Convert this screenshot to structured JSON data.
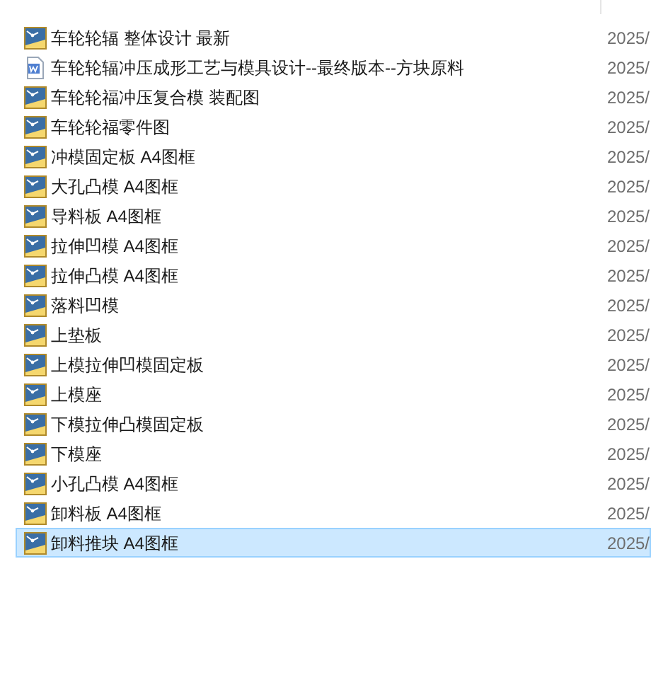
{
  "files": [
    {
      "name": "车轮轮辐 整体设计 最新",
      "kind": "drawing",
      "date": "2025/",
      "selected": false
    },
    {
      "name": "车轮轮辐冲压成形工艺与模具设计--最终版本--方块原料",
      "kind": "word",
      "date": "2025/",
      "selected": false
    },
    {
      "name": "车轮轮福冲压复合模 装配图",
      "kind": "drawing",
      "date": "2025/",
      "selected": false
    },
    {
      "name": "车轮轮福零件图",
      "kind": "drawing",
      "date": "2025/",
      "selected": false
    },
    {
      "name": "冲模固定板 A4图框",
      "kind": "drawing",
      "date": "2025/",
      "selected": false
    },
    {
      "name": "大孔凸模 A4图框",
      "kind": "drawing",
      "date": "2025/",
      "selected": false
    },
    {
      "name": "导料板 A4图框",
      "kind": "drawing",
      "date": "2025/",
      "selected": false
    },
    {
      "name": "拉伸凹模 A4图框",
      "kind": "drawing",
      "date": "2025/",
      "selected": false
    },
    {
      "name": "拉伸凸模 A4图框",
      "kind": "drawing",
      "date": "2025/",
      "selected": false
    },
    {
      "name": "落料凹模",
      "kind": "drawing",
      "date": "2025/",
      "selected": false
    },
    {
      "name": "上垫板",
      "kind": "drawing",
      "date": "2025/",
      "selected": false
    },
    {
      "name": "上模拉伸凹模固定板",
      "kind": "drawing",
      "date": "2025/",
      "selected": false
    },
    {
      "name": "上模座",
      "kind": "drawing",
      "date": "2025/",
      "selected": false
    },
    {
      "name": "下模拉伸凸模固定板",
      "kind": "drawing",
      "date": "2025/",
      "selected": false
    },
    {
      "name": "下模座",
      "kind": "drawing",
      "date": "2025/",
      "selected": false
    },
    {
      "name": "小孔凸模 A4图框",
      "kind": "drawing",
      "date": "2025/",
      "selected": false
    },
    {
      "name": "卸料板 A4图框",
      "kind": "drawing",
      "date": "2025/",
      "selected": false
    },
    {
      "name": "卸料推块 A4图框",
      "kind": "drawing",
      "date": "2025/",
      "selected": true
    }
  ]
}
